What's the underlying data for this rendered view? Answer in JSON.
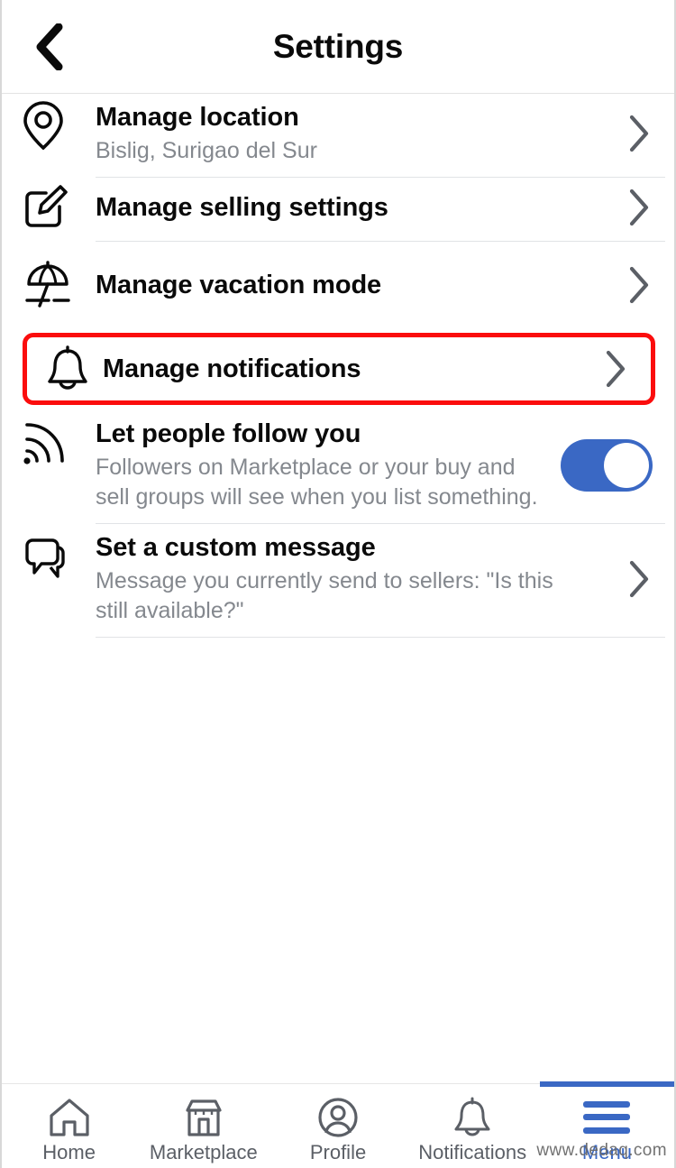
{
  "header": {
    "title": "Settings",
    "back_icon": "chevron-left-icon"
  },
  "settings_rows": [
    {
      "id": "manage-location",
      "icon": "location-pin-icon",
      "title": "Manage location",
      "subtitle": "Bislig, Surigao del Sur",
      "accessory": "chevron-right-icon",
      "highlighted": false
    },
    {
      "id": "manage-selling-settings",
      "icon": "edit-square-icon",
      "title": "Manage selling settings",
      "subtitle": "",
      "accessory": "chevron-right-icon",
      "highlighted": false
    },
    {
      "id": "manage-vacation-mode",
      "icon": "beach-umbrella-icon",
      "title": "Manage vacation mode",
      "subtitle": "",
      "accessory": "chevron-right-icon",
      "highlighted": false
    },
    {
      "id": "manage-notifications",
      "icon": "bell-icon",
      "title": "Manage notifications",
      "subtitle": "",
      "accessory": "chevron-right-icon",
      "highlighted": true
    },
    {
      "id": "let-people-follow-you",
      "icon": "rss-follow-icon",
      "title": "Let people follow you",
      "subtitle": "Followers on Marketplace or your buy and sell groups will see when you list something.",
      "accessory": "toggle",
      "toggle_on": true,
      "highlighted": false
    },
    {
      "id": "set-a-custom-message",
      "icon": "chat-bubbles-icon",
      "title": "Set a custom message",
      "subtitle": "Message you currently send to sellers: \"Is this still available?\"",
      "accessory": "chevron-right-icon",
      "highlighted": false
    }
  ],
  "bottom_nav": {
    "items": [
      {
        "id": "home",
        "icon": "home-icon",
        "label": "Home",
        "active": false
      },
      {
        "id": "marketplace",
        "icon": "storefront-icon",
        "label": "Marketplace",
        "active": false
      },
      {
        "id": "profile",
        "icon": "profile-circle-icon",
        "label": "Profile",
        "active": false
      },
      {
        "id": "notifications",
        "icon": "bell-icon",
        "label": "Notifications",
        "active": false
      },
      {
        "id": "menu",
        "icon": "hamburger-icon",
        "label": "Menu",
        "active": true
      }
    ]
  },
  "watermark": "www.dedaq.com",
  "colors": {
    "accent_blue": "#3a68c4",
    "highlight_red": "#fb0d0d",
    "primary_text": "#0a0a0a",
    "secondary_text": "#84888e",
    "chevron_gray": "#5b5f66",
    "divider": "#e1e3e6"
  }
}
